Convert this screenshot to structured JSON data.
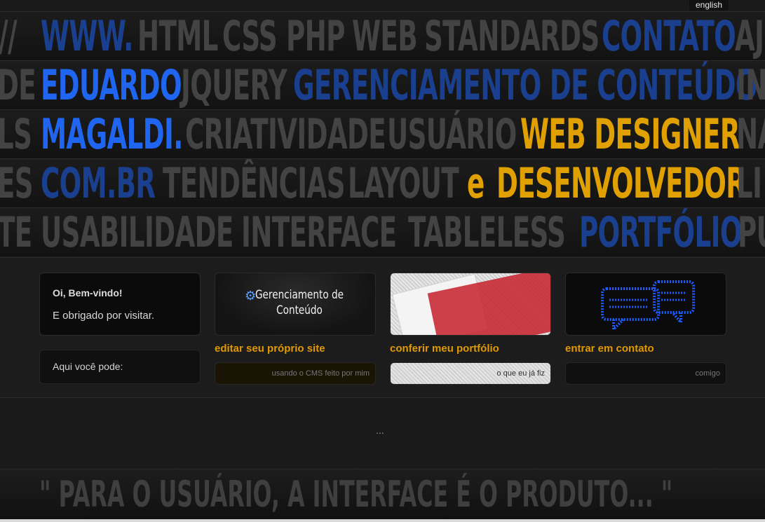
{
  "language_button": "english",
  "hero_rows": [
    [
      {
        "t": "//",
        "c": "gray"
      },
      {
        "t": "WWW.",
        "c": "navy"
      },
      {
        "t": "HTML",
        "c": "gray"
      },
      {
        "t": "CSS",
        "c": "gray"
      },
      {
        "t": "PHP",
        "c": "gray"
      },
      {
        "t": "WEB",
        "c": "gray"
      },
      {
        "t": "STANDARDS",
        "c": "gray"
      },
      {
        "t": "CONTATO",
        "c": "navy"
      },
      {
        "t": "AJ",
        "c": "gray"
      }
    ],
    [
      {
        "t": "DE",
        "c": "gray"
      },
      {
        "t": "EDUARDO",
        "c": "blue"
      },
      {
        "t": "JQUERY",
        "c": "gray"
      },
      {
        "t": "GERENCIAMENTO DE CONTEÚDO",
        "c": "navy"
      },
      {
        "t": "IN",
        "c": "gray"
      }
    ],
    [
      {
        "t": "LS",
        "c": "gray"
      },
      {
        "t": "MAGALDI.",
        "c": "blue"
      },
      {
        "t": "CRIATIVIDADE",
        "c": "gray"
      },
      {
        "t": "USUÁRIO",
        "c": "gray"
      },
      {
        "t": "WEB DESIGNER",
        "c": "gold"
      },
      {
        "t": "NA",
        "c": "gray"
      }
    ],
    [
      {
        "t": "ES",
        "c": "gray"
      },
      {
        "t": "COM.BR",
        "c": "navy"
      },
      {
        "t": "TENDÊNCIAS",
        "c": "gray"
      },
      {
        "t": "LAYOUT",
        "c": "gray"
      },
      {
        "t": "e",
        "c": "gold"
      },
      {
        "t": "DESENVOLVEDOR",
        "c": "gold"
      },
      {
        "t": "LI",
        "c": "gray"
      }
    ],
    [
      {
        "t": "TE",
        "c": "gray"
      },
      {
        "t": "USABILIDADE",
        "c": "gray"
      },
      {
        "t": "INTERFACE",
        "c": "gray"
      },
      {
        "t": "TABLELESS",
        "c": "gray"
      },
      {
        "t": "PORTFÓLIO",
        "c": "navy"
      },
      {
        "t": "PU",
        "c": "gray"
      }
    ]
  ],
  "welcome": {
    "title": "Oi, Bem-vindo!",
    "text": "E obrigado por visitar.",
    "you_can": "Aqui você pode:"
  },
  "cards": {
    "cms": {
      "image_title": "Gerenciamento de Conteúdo",
      "link": "editar seu próprio site",
      "sub": "usando o CMS feito por mim"
    },
    "portfolio": {
      "link": "conferir meu portfólio",
      "sub": "o que eu já fiz"
    },
    "contact": {
      "link": "entrar em contato",
      "sub": "comigo"
    }
  },
  "ellipsis": "...",
  "quote": "\" PARA O USUÁRIO, A INTERFACE É O PRODUTO... \"",
  "colors": {
    "blue": "#1f65f0",
    "navy": "#1a3f8f",
    "gold": "#e0a100",
    "gray": "#434343",
    "link": "#e09a00"
  }
}
